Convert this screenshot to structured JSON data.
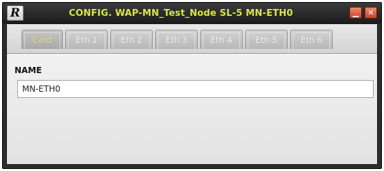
{
  "window": {
    "logo_text": "R",
    "title": "CONFIG. WAP-MN_Test_Node  SL-5  MN-ETH0",
    "minimize_label": "▁",
    "close_label": "✕",
    "title_color": "#d8e64a"
  },
  "tabs": [
    {
      "label": "Card",
      "active": true
    },
    {
      "label": "Eth 1",
      "active": false
    },
    {
      "label": "Eth 2",
      "active": false
    },
    {
      "label": "Eth 3",
      "active": false
    },
    {
      "label": "Eth 4",
      "active": false
    },
    {
      "label": "Eth 5",
      "active": false
    },
    {
      "label": "Eth 6",
      "active": false
    }
  ],
  "form": {
    "name_label": "NAME",
    "name_value": "MN-ETH0"
  },
  "icons": {
    "logo": "r-logo-icon",
    "minimize": "minimize-icon",
    "close": "close-icon"
  }
}
